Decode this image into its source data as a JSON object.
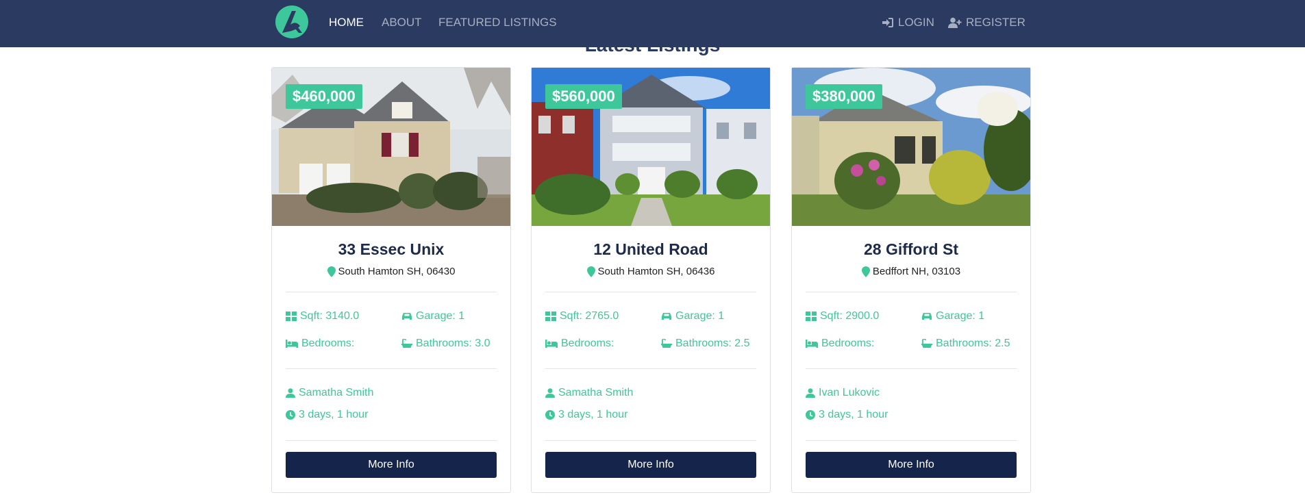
{
  "nav": {
    "logo_icon": "brand-logo-a",
    "links": [
      {
        "label": "HOME",
        "active": true
      },
      {
        "label": "ABOUT",
        "active": false
      },
      {
        "label": "FEATURED LISTINGS",
        "active": false
      }
    ],
    "login_label": "LOGIN",
    "register_label": "REGISTER"
  },
  "section_title": "Latest Listings",
  "colors": {
    "navbar": "#2b3a60",
    "accent": "#3ec79b",
    "button": "#15244b"
  },
  "listings": [
    {
      "price": "$460,000",
      "title": "33 Essec Unix",
      "location": "South Hamton SH, 06430",
      "sqft": "Sqft: 3140.0",
      "garage": "Garage: 1",
      "bedrooms": "Bedrooms:",
      "bathrooms": "Bathrooms: 3.0",
      "realtor": "Samatha Smith",
      "listed": "3 days, 1 hour",
      "button": "More Info"
    },
    {
      "price": "$560,000",
      "title": "12 United Road",
      "location": "South Hamton SH, 06436",
      "sqft": "Sqft: 2765.0",
      "garage": "Garage: 1",
      "bedrooms": "Bedrooms:",
      "bathrooms": "Bathrooms: 2.5",
      "realtor": "Samatha Smith",
      "listed": "3 days, 1 hour",
      "button": "More Info"
    },
    {
      "price": "$380,000",
      "title": "28 Gifford St",
      "location": "Bedffort NH, 03103",
      "sqft": "Sqft: 2900.0",
      "garage": "Garage: 1",
      "bedrooms": "Bedrooms:",
      "bathrooms": "Bathrooms: 2.5",
      "realtor": "Ivan Lukovic",
      "listed": "3 days, 1 hour",
      "button": "More Info"
    }
  ]
}
